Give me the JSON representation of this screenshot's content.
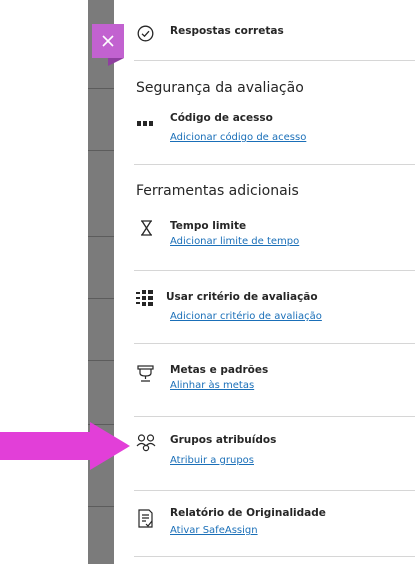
{
  "close_icon": "close-icon",
  "colors": {
    "accent": "#c262d0",
    "link": "#1a6fb8",
    "arrow": "#e23fd8",
    "strip": "#7b7b7b"
  },
  "top_item": {
    "title": "Respostas corretas",
    "icon": "check-circle-icon"
  },
  "security": {
    "heading": "Segurança da avaliação",
    "items": [
      {
        "title": "Código de acesso",
        "link": "Adicionar código de acesso",
        "icon": "access-code-icon"
      }
    ]
  },
  "tools": {
    "heading": "Ferramentas adicionais",
    "items": [
      {
        "title": "Tempo limite",
        "link": "Adicionar limite de tempo",
        "icon": "hourglass-icon"
      },
      {
        "title": "Usar critério de avaliação",
        "link": "Adicionar critério de avaliação",
        "icon": "rubric-icon"
      },
      {
        "title": "Metas e padrões",
        "link": "Alinhar às metas",
        "icon": "trophy-icon"
      },
      {
        "title": "Grupos atribuídos",
        "link": "Atribuir a grupos",
        "icon": "groups-icon"
      },
      {
        "title": "Relatório de Originalidade",
        "link": "Ativar SafeAssign",
        "icon": "report-icon"
      }
    ]
  }
}
